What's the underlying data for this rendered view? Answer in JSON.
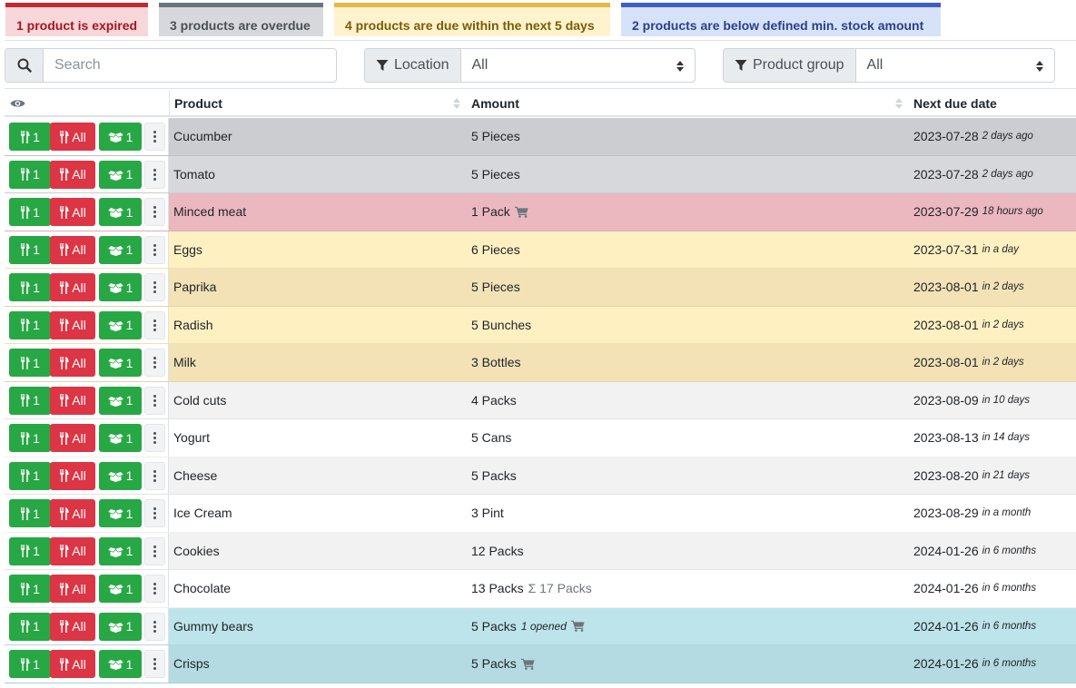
{
  "badges": {
    "expired": "1 product is expired",
    "overdue": "3 products are overdue",
    "due_soon": "4 products are due within the next 5 days",
    "below_min": "2 products are below defined min. stock amount"
  },
  "filters": {
    "search_placeholder": "Search",
    "location_label": "Location",
    "location_value": "All",
    "product_group_label": "Product group",
    "product_group_value": "All"
  },
  "table": {
    "columns": {
      "product": "Product",
      "amount": "Amount",
      "next_due_date": "Next due date"
    },
    "action_labels": {
      "consume_one": "1",
      "consume_all": "All",
      "open_one": "1"
    },
    "rows": [
      {
        "product": "Cucumber",
        "amount": "5 Pieces",
        "due_date": "2023-07-28",
        "due_relative": "2 days ago",
        "status": "overdue"
      },
      {
        "product": "Tomato",
        "amount": "5 Pieces",
        "due_date": "2023-07-28",
        "due_relative": "2 days ago",
        "status": "overdue"
      },
      {
        "product": "Minced meat",
        "amount": "1 Pack",
        "cart": true,
        "due_date": "2023-07-29",
        "due_relative": "18 hours ago",
        "status": "expired"
      },
      {
        "product": "Eggs",
        "amount": "6 Pieces",
        "due_date": "2023-07-31",
        "due_relative": "in a day",
        "status": "due"
      },
      {
        "product": "Paprika",
        "amount": "5 Pieces",
        "due_date": "2023-08-01",
        "due_relative": "in 2 days",
        "status": "due"
      },
      {
        "product": "Radish",
        "amount": "5 Bunches",
        "due_date": "2023-08-01",
        "due_relative": "in 2 days",
        "status": "due"
      },
      {
        "product": "Milk",
        "amount": "3 Bottles",
        "due_date": "2023-08-01",
        "due_relative": "in 2 days",
        "status": "due"
      },
      {
        "product": "Cold cuts",
        "amount": "4 Packs",
        "due_date": "2023-08-09",
        "due_relative": "in 10 days",
        "status": "normal"
      },
      {
        "product": "Yogurt",
        "amount": "5 Cans",
        "due_date": "2023-08-13",
        "due_relative": "in 14 days",
        "status": "normal"
      },
      {
        "product": "Cheese",
        "amount": "5 Packs",
        "due_date": "2023-08-20",
        "due_relative": "in 21 days",
        "status": "normal"
      },
      {
        "product": "Ice Cream",
        "amount": "3 Pint",
        "due_date": "2023-08-29",
        "due_relative": "in a month",
        "status": "normal"
      },
      {
        "product": "Cookies",
        "amount": "12 Packs",
        "due_date": "2024-01-26",
        "due_relative": "in 6 months",
        "status": "normal"
      },
      {
        "product": "Chocolate",
        "amount": "13 Packs",
        "aggregate": "17 Packs",
        "due_date": "2024-01-26",
        "due_relative": "in 6 months",
        "status": "normal"
      },
      {
        "product": "Gummy bears",
        "amount": "5 Packs",
        "opened": "1 opened",
        "cart": true,
        "due_date": "2024-01-26",
        "due_relative": "in 6 months",
        "status": "below"
      },
      {
        "product": "Crisps",
        "amount": "5 Packs",
        "cart": true,
        "due_date": "2024-01-26",
        "due_relative": "in 6 months",
        "status": "below"
      }
    ]
  },
  "colors": {
    "consume_button": "#28a745",
    "consume_all_button": "#dc3545",
    "expired_row": "#ebb8bf",
    "overdue_row": "#d6d8db",
    "due_row": "#fff0c2",
    "below_min_row": "#bde4ea"
  },
  "icons": [
    "search-icon",
    "filter-icon",
    "eye-icon",
    "utensils-icon",
    "box-open-icon",
    "kebab-menu-icon",
    "cart-icon",
    "sigma-icon"
  ]
}
